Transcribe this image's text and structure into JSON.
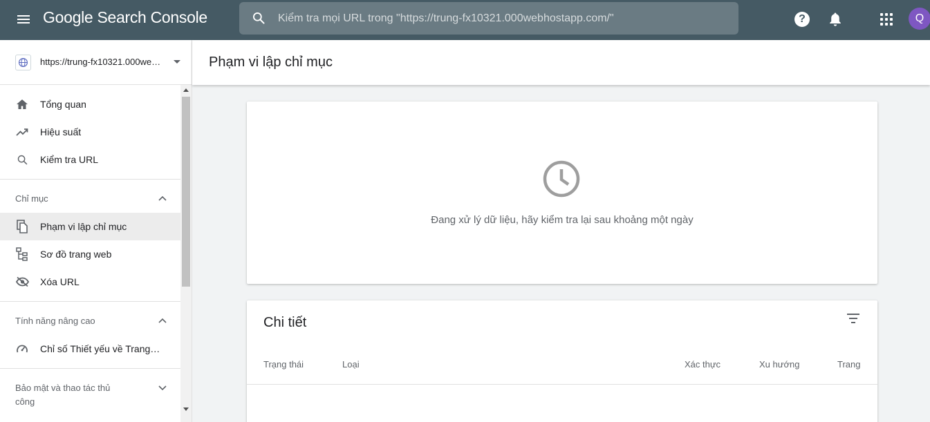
{
  "app": {
    "title": "Google Search Console"
  },
  "search": {
    "placeholder": "Kiểm tra mọi URL trong \"https://trung-fx10321.000webhostapp.com/\""
  },
  "account": {
    "initial": "Q",
    "color": "#7e57c2"
  },
  "colors": {
    "topbar": "#455a64",
    "active_nav": "#ececec"
  },
  "property": {
    "url": "https://trung-fx10321.000webhostapp.com/"
  },
  "sidebar": {
    "main_items": [
      {
        "label": "Tổng quan",
        "icon": "home-icon"
      },
      {
        "label": "Hiệu suất",
        "icon": "trending-up-icon"
      },
      {
        "label": "Kiểm tra URL",
        "icon": "search-icon"
      }
    ],
    "sections": [
      {
        "title": "Chỉ mục",
        "expanded": true,
        "items": [
          {
            "label": "Phạm vi lập chỉ mục",
            "icon": "copy-pages-icon",
            "active": true
          },
          {
            "label": "Sơ đồ trang web",
            "icon": "sitemap-icon"
          },
          {
            "label": "Xóa URL",
            "icon": "eye-off-icon"
          }
        ]
      },
      {
        "title": "Tính năng nâng cao",
        "expanded": true,
        "items": [
          {
            "label": "Chỉ số Thiết yếu về Trang web",
            "icon": "speedometer-icon"
          }
        ]
      },
      {
        "title": "Bảo mật và thao tác thủ công",
        "expanded": false,
        "items": []
      }
    ]
  },
  "page": {
    "title": "Phạm vi lập chỉ mục"
  },
  "empty_state": {
    "message": "Đang xử lý dữ liệu, hãy kiểm tra lại sau khoảng một ngày",
    "icon": "clock-icon"
  },
  "details": {
    "title": "Chi tiết",
    "columns": [
      "Trạng thái",
      "Loại",
      "Xác thực",
      "Xu hướng",
      "Trang"
    ]
  }
}
